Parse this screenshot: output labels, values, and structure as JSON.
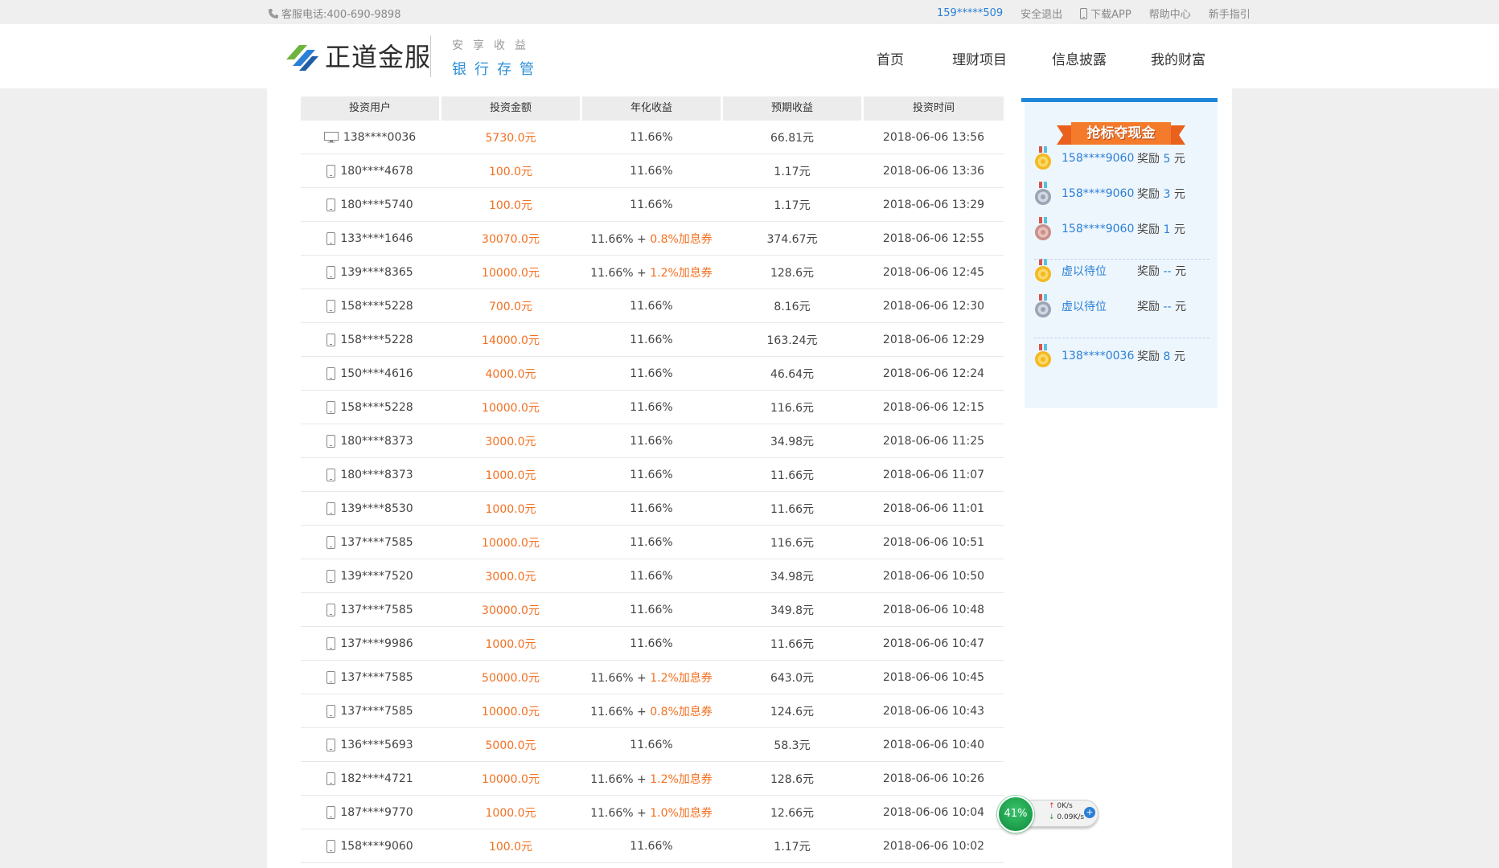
{
  "topbar": {
    "phone": "客服电话:400-690-9898",
    "user": "159*****509",
    "logout": "安全退出",
    "download": "下载APP",
    "help": "帮助中心",
    "guide": "新手指引"
  },
  "header": {
    "logo_text": "正道金服",
    "slogan_1": "安享收益",
    "slogan_2": "银行存管",
    "nav": [
      "首页",
      "理财项目",
      "信息披露",
      "我的财富"
    ]
  },
  "table": {
    "headers": [
      "投资用户",
      "投资金额",
      "年化收益",
      "预期收益",
      "投资时间"
    ],
    "rows": [
      {
        "device": "desktop-icon",
        "user": "138****0036",
        "amount": "5730.0元",
        "rate": "11.66%",
        "bonus": "",
        "expected": "66.81元",
        "time": "2018-06-06 13:56"
      },
      {
        "device": "mobile-icon",
        "user": "180****4678",
        "amount": "100.0元",
        "rate": "11.66%",
        "bonus": "",
        "expected": "1.17元",
        "time": "2018-06-06 13:36"
      },
      {
        "device": "mobile-icon",
        "user": "180****5740",
        "amount": "100.0元",
        "rate": "11.66%",
        "bonus": "",
        "expected": "1.17元",
        "time": "2018-06-06 13:29"
      },
      {
        "device": "mobile-icon",
        "user": "133****1646",
        "amount": "30070.0元",
        "rate": "11.66% + ",
        "bonus": "0.8%加息券",
        "expected": "374.67元",
        "time": "2018-06-06 12:55"
      },
      {
        "device": "mobile-icon",
        "user": "139****8365",
        "amount": "10000.0元",
        "rate": "11.66% + ",
        "bonus": "1.2%加息券",
        "expected": "128.6元",
        "time": "2018-06-06 12:45"
      },
      {
        "device": "mobile-icon",
        "user": "158****5228",
        "amount": "700.0元",
        "rate": "11.66%",
        "bonus": "",
        "expected": "8.16元",
        "time": "2018-06-06 12:30"
      },
      {
        "device": "mobile-icon",
        "user": "158****5228",
        "amount": "14000.0元",
        "rate": "11.66%",
        "bonus": "",
        "expected": "163.24元",
        "time": "2018-06-06 12:29"
      },
      {
        "device": "mobile-icon",
        "user": "150****4616",
        "amount": "4000.0元",
        "rate": "11.66%",
        "bonus": "",
        "expected": "46.64元",
        "time": "2018-06-06 12:24"
      },
      {
        "device": "mobile-icon",
        "user": "158****5228",
        "amount": "10000.0元",
        "rate": "11.66%",
        "bonus": "",
        "expected": "116.6元",
        "time": "2018-06-06 12:15"
      },
      {
        "device": "mobile-icon",
        "user": "180****8373",
        "amount": "3000.0元",
        "rate": "11.66%",
        "bonus": "",
        "expected": "34.98元",
        "time": "2018-06-06 11:25"
      },
      {
        "device": "mobile-icon",
        "user": "180****8373",
        "amount": "1000.0元",
        "rate": "11.66%",
        "bonus": "",
        "expected": "11.66元",
        "time": "2018-06-06 11:07"
      },
      {
        "device": "mobile-icon",
        "user": "139****8530",
        "amount": "1000.0元",
        "rate": "11.66%",
        "bonus": "",
        "expected": "11.66元",
        "time": "2018-06-06 11:01"
      },
      {
        "device": "mobile-icon",
        "user": "137****7585",
        "amount": "10000.0元",
        "rate": "11.66%",
        "bonus": "",
        "expected": "116.6元",
        "time": "2018-06-06 10:51"
      },
      {
        "device": "mobile-icon",
        "user": "139****7520",
        "amount": "3000.0元",
        "rate": "11.66%",
        "bonus": "",
        "expected": "34.98元",
        "time": "2018-06-06 10:50"
      },
      {
        "device": "mobile-icon",
        "user": "137****7585",
        "amount": "30000.0元",
        "rate": "11.66%",
        "bonus": "",
        "expected": "349.8元",
        "time": "2018-06-06 10:48"
      },
      {
        "device": "mobile-icon",
        "user": "137****9986",
        "amount": "1000.0元",
        "rate": "11.66%",
        "bonus": "",
        "expected": "11.66元",
        "time": "2018-06-06 10:47"
      },
      {
        "device": "mobile-icon",
        "user": "137****7585",
        "amount": "50000.0元",
        "rate": "11.66% + ",
        "bonus": "1.2%加息券",
        "expected": "643.0元",
        "time": "2018-06-06 10:45"
      },
      {
        "device": "mobile-icon",
        "user": "137****7585",
        "amount": "10000.0元",
        "rate": "11.66% + ",
        "bonus": "0.8%加息券",
        "expected": "124.6元",
        "time": "2018-06-06 10:43"
      },
      {
        "device": "mobile-icon",
        "user": "136****5693",
        "amount": "5000.0元",
        "rate": "11.66%",
        "bonus": "",
        "expected": "58.3元",
        "time": "2018-06-06 10:40"
      },
      {
        "device": "mobile-icon",
        "user": "182****4721",
        "amount": "10000.0元",
        "rate": "11.66% + ",
        "bonus": "1.2%加息券",
        "expected": "128.6元",
        "time": "2018-06-06 10:26"
      },
      {
        "device": "mobile-icon",
        "user": "187****9770",
        "amount": "1000.0元",
        "rate": "11.66% + ",
        "bonus": "1.0%加息券",
        "expected": "12.66元",
        "time": "2018-06-06 10:04"
      },
      {
        "device": "mobile-icon",
        "user": "158****9060",
        "amount": "100.0元",
        "rate": "11.66%",
        "bonus": "",
        "expected": "1.17元",
        "time": "2018-06-06 10:02"
      }
    ]
  },
  "sidebar": {
    "title": "抢标夺现金",
    "ranks": [
      {
        "medal": "gold-medal-icon",
        "user": "158****9060",
        "reward_prefix": "奖励 ",
        "amount": "5",
        "unit": " 元"
      },
      {
        "medal": "silver-medal-icon",
        "user": "158****9060",
        "reward_prefix": "奖励 ",
        "amount": "3",
        "unit": " 元"
      },
      {
        "medal": "bronze-medal-icon",
        "user": "158****9060",
        "reward_prefix": "奖励 ",
        "amount": "1",
        "unit": " 元"
      },
      {
        "medal": "gold-medal-icon",
        "user": "虚以待位",
        "reward_prefix": "奖励 ",
        "amount": "--",
        "unit": " 元"
      },
      {
        "medal": "silver-medal-icon",
        "user": "虚以待位",
        "reward_prefix": "奖励 ",
        "amount": "--",
        "unit": " 元"
      },
      {
        "medal": "gold-medal-icon",
        "user": "138****0036",
        "reward_prefix": "奖励 ",
        "amount": "8",
        "unit": " 元"
      }
    ]
  },
  "speed_widget": {
    "percent": "41%",
    "up": "0K/s",
    "down": "0.09K/s",
    "plus": "+"
  },
  "colors": {
    "accent_blue": "#2a7fd6",
    "amount_orange": "#f37021",
    "header_blue": "#1d86d9"
  }
}
